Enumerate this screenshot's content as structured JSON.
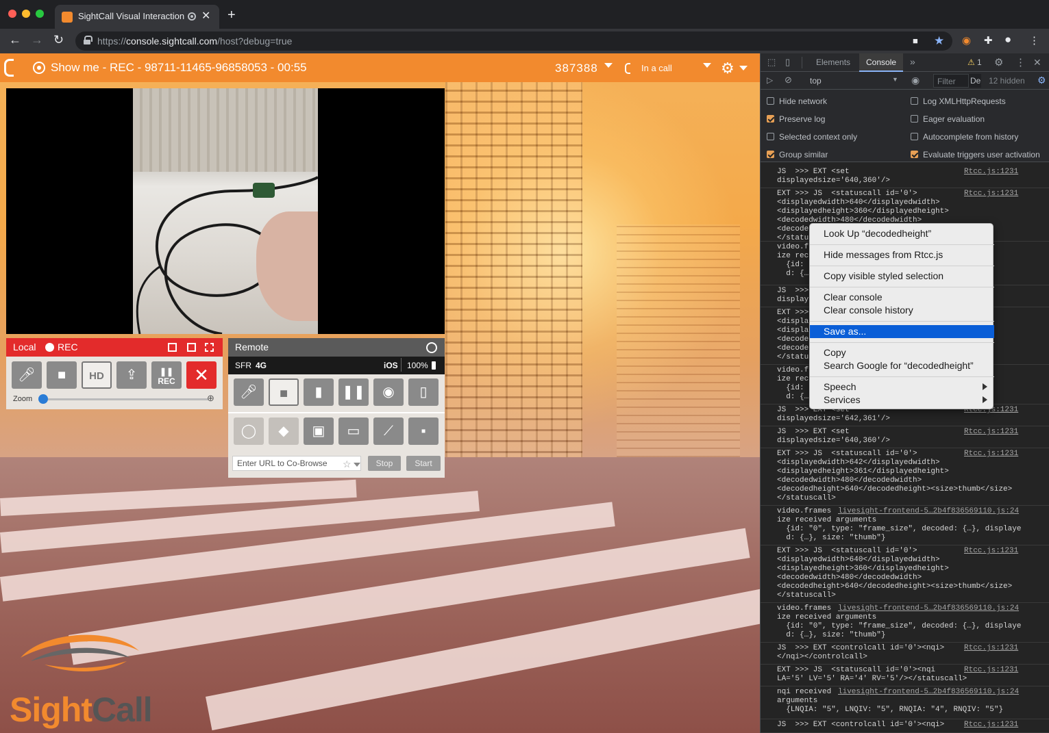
{
  "browser": {
    "tab_title": "SightCall Visual Interaction",
    "url_scheme": "https://",
    "url_host": "console.sightcall.com",
    "url_path": "/host?debug=true"
  },
  "app": {
    "call_title": "Show me - REC - 98711-11465-96858053 - 00:55",
    "code": "387388",
    "call_status": "In a call"
  },
  "local": {
    "label": "Local",
    "rec_label": "REC",
    "hd_label": "HD",
    "pause_rec_label": "REC",
    "zoom_label": "Zoom"
  },
  "remote": {
    "label": "Remote",
    "carrier": "SFR",
    "network": "4G",
    "os": "iOS",
    "battery": "100%",
    "cobrowse_placeholder": "Enter URL to Co-Browse",
    "stop_label": "Stop",
    "start_label": "Start"
  },
  "logo": {
    "sight": "Sight",
    "call": "Call"
  },
  "devtools": {
    "tabs": [
      "Elements",
      "Console"
    ],
    "warning_count": "1",
    "context": "top",
    "filter_placeholder": "Filter",
    "level": "De",
    "hidden": "12 hidden",
    "options_left": [
      {
        "label": "Hide network",
        "checked": false
      },
      {
        "label": "Preserve log",
        "checked": true
      },
      {
        "label": "Selected context only",
        "checked": false
      },
      {
        "label": "Group similar",
        "checked": true
      }
    ],
    "options_right": [
      {
        "label": "Log XMLHttpRequests",
        "checked": false
      },
      {
        "label": "Eager evaluation",
        "checked": false
      },
      {
        "label": "Autocomplete from history",
        "checked": false
      },
      {
        "label": "Evaluate triggers user activation",
        "checked": true
      }
    ],
    "messages": [
      {
        "text": "JS  >>> EXT <set\ndisplayedsize='640,360'/>",
        "src": "Rtcc.js:1231",
        "h": 32
      },
      {
        "text": "EXT >>> JS  <statuscall id='0'>\n<displayedwidth>640</displayedwidth>\n<displayedheight>360</displayedheight>\n<decodedwidth>480</decodedwidth>\n<decode\n</statu",
        "src": "Rtcc.js:1231",
        "h": 78
      },
      {
        "text": "video.f\nize rec\n  {id:\n  d: {…",
        "src": "",
        "h": 64
      },
      {
        "text": "JS  >>>\ndisplay",
        "src": "",
        "h": 32
      },
      {
        "text": "EXT >>>\n<displa\n<displa\n<decode\n<decode\n</statu",
        "src": "",
        "h": 84
      },
      {
        "text": "video.f\nize rec\n  {id:\n  d: {…",
        "src": "",
        "h": 58
      },
      {
        "text": "JS  >>> EXT <set\ndisplayedsize='642,361'/>",
        "src": "Rtcc.js:1231",
        "h": 32
      },
      {
        "text": "JS  >>> EXT <set\ndisplayedsize='640,360'/>",
        "src": "Rtcc.js:1231",
        "h": 32
      },
      {
        "text": "EXT >>> JS  <statuscall id='0'>\n<displayedwidth>642</displayedwidth>\n<displayedheight>361</displayedheight>\n<decodedwidth>480</decodedwidth>\n<decodedheight>640</decodedheight><size>thumb</size>\n</statuscall>",
        "src": "Rtcc.js:1231",
        "h": 84
      },
      {
        "text": "video.frames\nize received arguments\n  {id: \"0\", type: \"frame_size\", decoded: {…}, displaye\n  d: {…}, size: \"thumb\"}",
        "src": "livesight-frontend-5…2b4f836569110.js:24",
        "h": 58
      },
      {
        "text": "EXT >>> JS  <statuscall id='0'>\n<displayedwidth>640</displayedwidth>\n<displayedheight>360</displayedheight>\n<decodedwidth>480</decodedwidth>\n<decodedheight>640</decodedheight><size>thumb</size>\n</statuscall>",
        "src": "Rtcc.js:1231",
        "h": 84
      },
      {
        "text": "video.frames\nize received arguments\n  {id: \"0\", type: \"frame_size\", decoded: {…}, displaye\n  d: {…}, size: \"thumb\"}",
        "src": "livesight-frontend-5…2b4f836569110.js:24",
        "h": 58
      },
      {
        "text": "JS  >>> EXT <controlcall id='0'><nqi>\n</nqi></controlcall>",
        "src": "Rtcc.js:1231",
        "h": 32
      },
      {
        "text": "EXT >>> JS  <statuscall id='0'><nqi\nLA='5' LV='5' RA='4' RV='5'/></statuscall>",
        "src": "Rtcc.js:1231",
        "h": 32
      },
      {
        "text": "nqi received\narguments\n  {LNQIA: \"5\", LNQIV: \"5\", RNQIA: \"4\", RNQIV: \"5\"}",
        "src": "livesight-frontend-5…2b4f836569110.js:24",
        "h": 48
      },
      {
        "text": "JS  >>> EXT <controlcall id='0'><nqi>",
        "src": "Rtcc.js:1231",
        "h": 20
      }
    ]
  },
  "context_menu": {
    "items": [
      {
        "label": "Look Up “decodedheight”",
        "highlight": false
      },
      {
        "label": "Hide messages from Rtcc.js",
        "highlight": false
      },
      {
        "label": "Copy visible styled selection",
        "highlight": false
      },
      {
        "label": "Clear console",
        "highlight": false
      },
      {
        "label": "Clear console history",
        "highlight": false
      },
      {
        "label": "Save as...",
        "highlight": true
      },
      {
        "label": "Copy",
        "highlight": false
      },
      {
        "label": "Search Google for “decodedheight”",
        "highlight": false
      },
      {
        "label": "Speech",
        "highlight": false
      },
      {
        "label": "Services",
        "highlight": false
      }
    ]
  },
  "colors": {
    "brand": "#f28a2e",
    "rec_red": "#e32b2b",
    "menu_highlight": "#0a5ed7"
  }
}
